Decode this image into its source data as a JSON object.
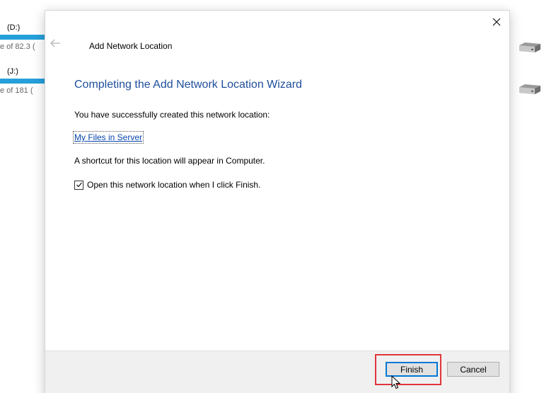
{
  "background": {
    "drives": [
      {
        "label": "(D:)",
        "free_text": "e of 82.3 ("
      },
      {
        "label": "(J:)",
        "free_text": "e of 181 ("
      }
    ]
  },
  "dialog": {
    "title": "Add Network Location",
    "heading": "Completing the Add Network Location Wizard",
    "created_message": "You have successfully created this network location:",
    "location_link": "My Files in Server",
    "shortcut_message": "A shortcut for this location will appear in Computer.",
    "open_checkbox": {
      "label": "Open this network location when I click Finish.",
      "checked": true
    },
    "buttons": {
      "finish": "Finish",
      "cancel": "Cancel"
    },
    "icons": {
      "close": "close-icon",
      "back": "back-arrow-icon",
      "drive": "hard-drive-icon",
      "cursor": "mouse-pointer-icon"
    }
  },
  "colors": {
    "heading": "#1e4e9a",
    "link": "#0645ad",
    "progress_bar": "#26a0da",
    "highlight": "#e0363b",
    "focus_border": "#0078d7"
  }
}
